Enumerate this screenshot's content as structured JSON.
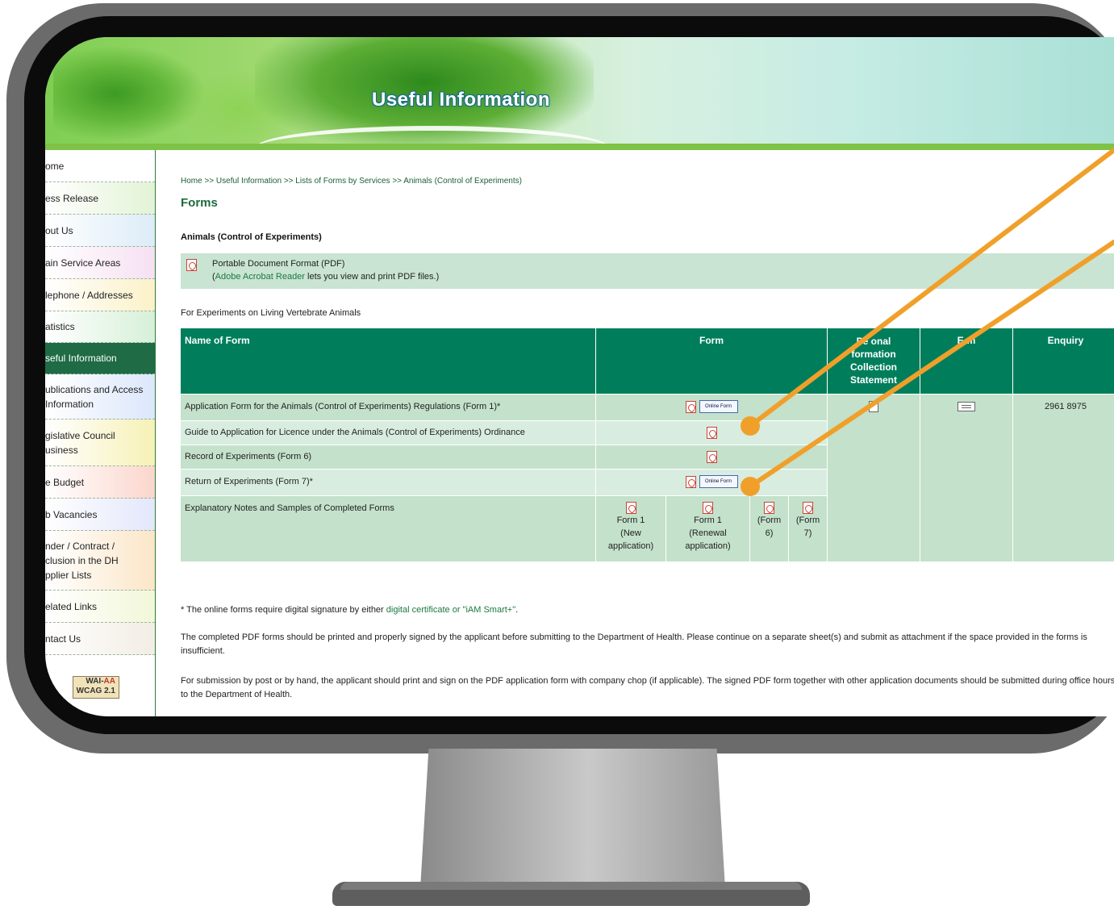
{
  "banner": {
    "title": "Useful Information"
  },
  "sidebar": {
    "items": [
      {
        "label": "ome"
      },
      {
        "label": "ess Release"
      },
      {
        "label": "out Us"
      },
      {
        "label": "ain Service Areas"
      },
      {
        "label": "lephone / Addresses"
      },
      {
        "label": "atistics"
      },
      {
        "label": "seful Information"
      },
      {
        "label": "ublications and Access\nInformation"
      },
      {
        "label": "gislative Council\nusiness"
      },
      {
        "label": "e Budget"
      },
      {
        "label": "b Vacancies"
      },
      {
        "label": "nder / Contract /\nclusion in the DH\npplier Lists"
      },
      {
        "label": "elated Links"
      },
      {
        "label": "ntact Us"
      }
    ],
    "badge": {
      "line1_a": "WAI-",
      "line1_b": "AA",
      "line2": "WCAG 2.1"
    }
  },
  "main": {
    "breadcrumb": "Home >> Useful Information >> Lists of Forms by Services >> Animals (Control of Experiments)",
    "title": "Forms",
    "section": "Animals (Control of Experiments)",
    "pdf_notice": {
      "line1": "Portable Document Format (PDF)",
      "link": "Adobe Acrobat Reader",
      "line2_rest": " lets you view and print PDF files.)",
      "line2_open": "("
    },
    "subheading": "For Experiments on Living Vertebrate Animals",
    "table": {
      "headers": {
        "name": "Name of Form",
        "form": "Form",
        "pics": "Personal\nInformation\nCollection\nStatement",
        "pics_visible": "Pe   onal\n  formation\nCollection\nStatement",
        "email": "E-m",
        "enquiry": "Enquiry"
      },
      "rows": [
        {
          "name": "Application Form for the Animals (Control of Experiments) Regulations (Form 1)*",
          "online": "Online Form"
        },
        {
          "name": "Guide to Application for Licence under the Animals (Control of Experiments) Ordinance"
        },
        {
          "name": "Record of Experiments (Form 6)"
        },
        {
          "name": "Return of Experiments (Form 7)*",
          "online": "Online Form"
        },
        {
          "name": "Explanatory Notes and Samples of Completed Forms"
        }
      ],
      "samples": [
        {
          "label": "Form 1\n(New\napplication)"
        },
        {
          "label": "Form 1\n(Renewal\napplication)"
        },
        {
          "label": "(Form\n6)"
        },
        {
          "label": "(Form\n7)"
        }
      ],
      "enquiry_phone": "2961 8975"
    },
    "notes": {
      "star_prefix": "* The online forms require digital signature by either ",
      "star_link": "digital certificate or \"iAM Smart+\"",
      "star_suffix": ".",
      "p2": "The completed PDF forms should be printed and properly signed by the applicant before submitting to the Department of Health. Please continue on a separate sheet(s) and submit as attachment if the space provided in the forms is insufficient.",
      "p3": "For submission by post or by hand, the applicant should print and sign on the PDF application form with company chop (if applicable). The signed PDF form together with other application documents should be submitted during office hours to the Department of Health."
    }
  },
  "colors": {
    "header_green": "#007e5c",
    "row_green": "#c4e1cb",
    "arrow_orange": "#f0a02a",
    "monitor_bezel": "#0b0b0b"
  }
}
